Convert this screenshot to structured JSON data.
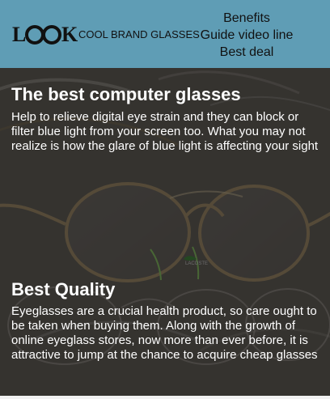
{
  "brand": {
    "logo_word": "Look",
    "tagline": "COOL BRAND GLASSES"
  },
  "navigation": {
    "items": [
      {
        "label": "Benefits"
      },
      {
        "label": "Guide video line"
      },
      {
        "label": "Best deal"
      }
    ]
  },
  "hero": {
    "frame_brand_label": "LACOSTE",
    "sections": [
      {
        "title": "The best computer glasses",
        "body": "Help to relieve digital eye strain and they can block or filter blue light from your screen too. What you may not realize is how the glare of blue light is affecting your sight"
      },
      {
        "title": "Best Quality",
        "body": "Eyeglasses are a crucial health product, so care ought to be taken when buying them. Along with the growth of online eyeglass stores, now more than ever before, it is attractive to jump at the chance to acquire cheap glasses"
      }
    ]
  },
  "colors": {
    "header_bg": "#5f9db5",
    "text_dark": "#111111",
    "hero_text": "#ffffff",
    "frame_gold": "#b7a17a"
  },
  "icons": {
    "logo": "stylized-look-glasses-logo"
  }
}
